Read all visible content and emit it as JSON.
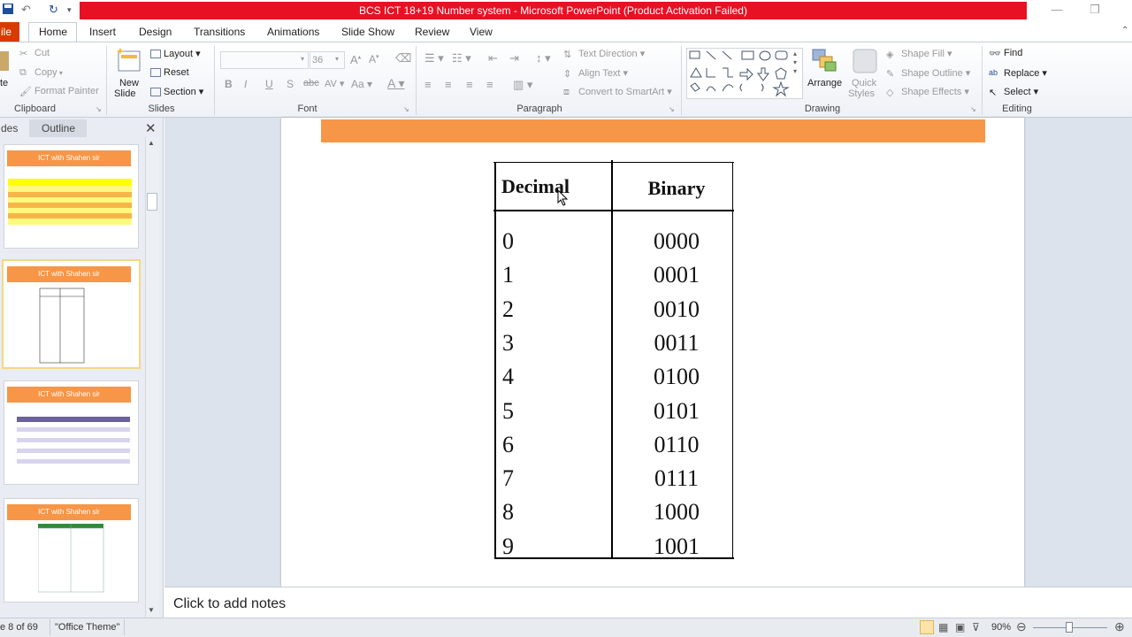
{
  "window": {
    "title": "BCS ICT  18+19 Number system  - Microsoft PowerPoint (Product Activation Failed)"
  },
  "tabs": {
    "file": "ile",
    "items": [
      "Home",
      "Insert",
      "Design",
      "Transitions",
      "Animations",
      "Slide Show",
      "Review",
      "View"
    ]
  },
  "ribbon": {
    "clipboard": {
      "cut": "Cut",
      "copy": "Copy",
      "paste": "te",
      "format_painter": "Format Painter",
      "label": "Clipboard"
    },
    "slides": {
      "new_slide_line1": "New",
      "new_slide_line2": "Slide",
      "layout": "Layout",
      "reset": "Reset",
      "section": "Section",
      "label": "Slides"
    },
    "font": {
      "size": "36",
      "bold": "B",
      "italic": "I",
      "underline": "U",
      "strike": "S",
      "label": "Font"
    },
    "paragraph": {
      "text_direction": "Text Direction",
      "align_text": "Align Text",
      "convert_smartart": "Convert to SmartArt",
      "label": "Paragraph"
    },
    "drawing": {
      "arrange": "Arrange",
      "quick_styles_1": "Quick",
      "quick_styles_2": "Styles",
      "shape_fill": "Shape Fill",
      "shape_outline": "Shape Outline",
      "shape_effects": "Shape Effects",
      "label": "Drawing"
    },
    "editing": {
      "find": "Find",
      "replace": "Replace",
      "select": "Select",
      "label": "Editing"
    }
  },
  "pane": {
    "tab_slides": "des",
    "tab_outline": "Outline",
    "thumb_title": "ICT with Shahen sir"
  },
  "slide": {
    "table": {
      "headers": [
        "Decimal",
        "Binary"
      ],
      "rows": [
        [
          "0",
          "0000"
        ],
        [
          "1",
          "0001"
        ],
        [
          "2",
          "0010"
        ],
        [
          "3",
          "0011"
        ],
        [
          "4",
          "0100"
        ],
        [
          "5",
          "0101"
        ],
        [
          "6",
          "0110"
        ],
        [
          "7",
          "0111"
        ],
        [
          "8",
          "1000"
        ],
        [
          "9",
          "1001"
        ]
      ]
    }
  },
  "notes": {
    "placeholder": "Click to add notes"
  },
  "status": {
    "slide_num": "e 8 of 69",
    "theme": "\"Office Theme\"",
    "zoom": "90%"
  }
}
